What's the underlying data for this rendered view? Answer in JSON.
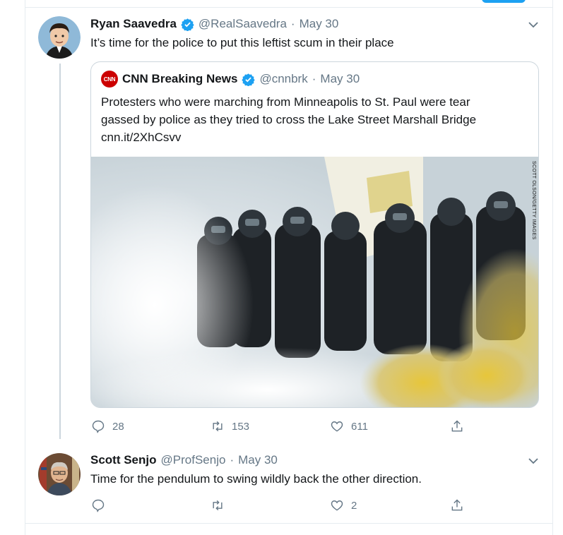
{
  "tweet1": {
    "name": "Ryan Saavedra",
    "handle": "@RealSaavedra",
    "sep": "·",
    "date": "May 30",
    "text": "It’s time for the police to put this leftist scum in their place",
    "stats": {
      "replies": "28",
      "retweets": "153",
      "likes": "611"
    }
  },
  "quote": {
    "name": "CNN Breaking News",
    "handle": "@cnnbrk",
    "sep": "·",
    "date": "May 30",
    "logo_text": "CNN",
    "text_line1": "Protesters who were marching from Minneapolis to St. Paul were tear",
    "text_line2": "gassed by police as they tried to cross the Lake Street Marshall Bridge",
    "link": "cnn.it/2XhCsvv",
    "image_credit": "SCOTT OLSON/GETTY IMAGES"
  },
  "tweet2": {
    "name": "Scott Senjo",
    "handle": "@ProfSenjo",
    "sep": "·",
    "date": "May 30",
    "text": "Time for the pendulum to swing wildly back the other direction.",
    "stats": {
      "replies": "",
      "retweets": "",
      "likes": "2"
    }
  },
  "colors": {
    "accent": "#1da1f2",
    "muted": "#657786",
    "cnn_red": "#cc0000"
  }
}
